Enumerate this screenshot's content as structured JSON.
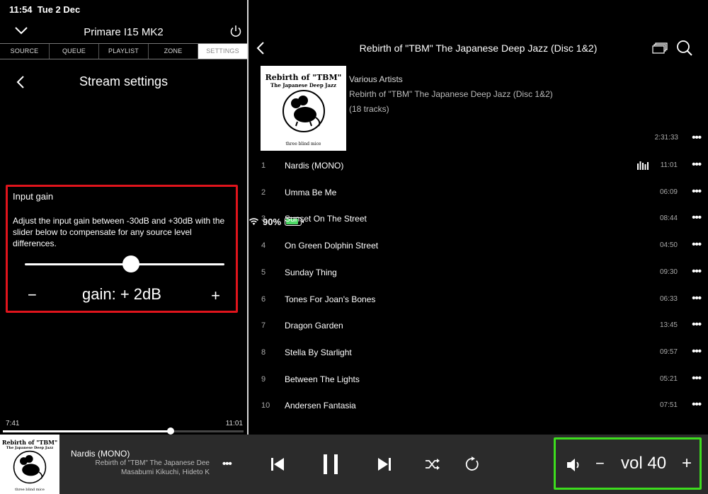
{
  "status_bar": {
    "time": "11:54",
    "date": "Tue 2 Dec",
    "battery": "90%",
    "battery_level": 0.9
  },
  "left": {
    "device_name": "Primare I15 MK2",
    "tabs": [
      "SOURCE",
      "QUEUE",
      "PLAYLIST",
      "ZONE",
      "SETTINGS"
    ],
    "active_tab": "SETTINGS",
    "page_title": "Stream settings",
    "gain": {
      "title": "Input gain",
      "description": "Adjust the input gain between -30dB and +30dB with the slider below to compensate for any source level differences.",
      "minus": "−",
      "plus": "+",
      "value_label": "gain: + 2dB",
      "value_db": 2,
      "min_db": -30,
      "max_db": 30
    },
    "progress": {
      "elapsed": "7:41",
      "total": "11:01",
      "fraction": 0.698
    }
  },
  "album": {
    "header_title": "Rebirth of \"TBM\" The Japanese Deep Jazz (Disc 1&2)",
    "cover": {
      "line1": "Rebirth of \"TBM\"",
      "line2": "The Japanese Deep Jazz",
      "line3": "three blind mice"
    },
    "artist": "Various Artists",
    "title": "Rebirth of \"TBM\" The Japanese Deep Jazz (Disc 1&2)",
    "track_count": "(18 tracks)",
    "total_duration": "2:31:33",
    "tracks": [
      {
        "num": "1",
        "name": "Nardis (MONO)",
        "duration": "11:01",
        "playing": true
      },
      {
        "num": "2",
        "name": "Umma Be Me",
        "duration": "06:09"
      },
      {
        "num": "3",
        "name": "Sunset On The Street",
        "duration": "08:44"
      },
      {
        "num": "4",
        "name": "On Green Dolphin Street",
        "duration": "04:50"
      },
      {
        "num": "5",
        "name": "Sunday Thing",
        "duration": "09:30"
      },
      {
        "num": "6",
        "name": "Tones For Joan's Bones",
        "duration": "06:33"
      },
      {
        "num": "7",
        "name": "Dragon Garden",
        "duration": "13:45"
      },
      {
        "num": "8",
        "name": "Stella By Starlight",
        "duration": "09:57"
      },
      {
        "num": "9",
        "name": "Between The Lights",
        "duration": "05:21"
      },
      {
        "num": "10",
        "name": "Andersen Fantasia",
        "duration": "07:51"
      }
    ]
  },
  "player": {
    "title": "Nardis (MONO)",
    "album": "Rebirth of \"TBM\" The Japanese Dee",
    "artists": "Masabumi Kikuchi, Hideto K",
    "volume_label": "vol 40",
    "minus": "−",
    "plus": "+"
  },
  "colors": {
    "gain_highlight": "#e0141c",
    "volume_highlight": "#3ddc1e",
    "battery": "#4cd964"
  }
}
